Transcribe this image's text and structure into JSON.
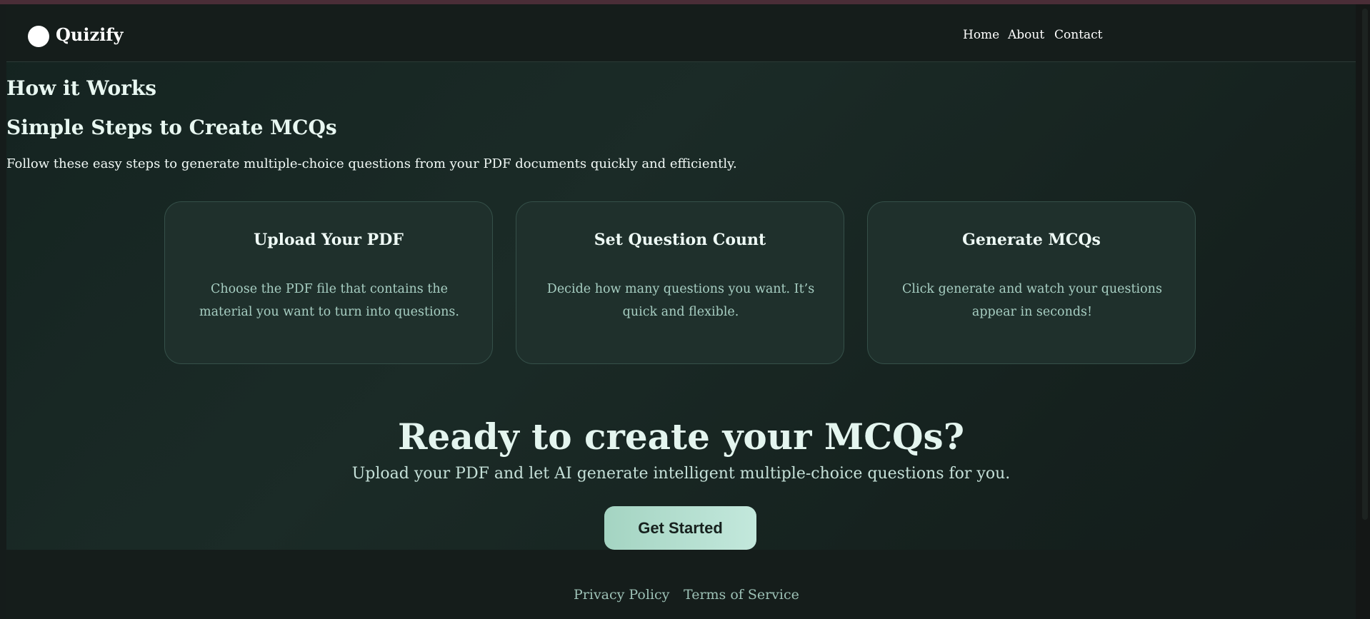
{
  "header": {
    "logo_text": "Quizify",
    "nav": [
      "Home",
      "About",
      "Contact"
    ]
  },
  "how": {
    "heading": "How it Works",
    "subheading": "Simple Steps to Create MCQs",
    "intro": "Follow these easy steps to generate multiple-choice questions from your PDF documents quickly and efficiently."
  },
  "steps": [
    {
      "title": "Upload Your PDF",
      "description": "Choose the PDF file that contains the material you want to turn into questions."
    },
    {
      "title": "Set Question Count",
      "description": "Decide how many questions you want. It’s quick and flexible."
    },
    {
      "title": "Generate MCQs",
      "description": "Click generate and watch your questions appear in seconds!"
    }
  ],
  "cta": {
    "title": "Ready to create your MCQs?",
    "subtitle": "Upload your PDF and let AI generate intelligent multiple-choice questions for you.",
    "button": "Get Started"
  },
  "footer": {
    "links": [
      "Privacy Policy",
      "Terms of Service"
    ]
  },
  "colors": {
    "background": "#151c1b",
    "card": "#1f302c",
    "accent": "#a4d4c2"
  }
}
